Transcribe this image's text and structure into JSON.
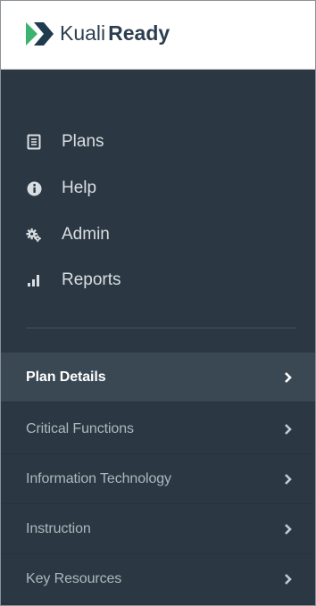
{
  "brand": {
    "name_light": "Kuali",
    "name_bold": "Ready"
  },
  "colors": {
    "sidebar_bg": "#2b3843",
    "active_bg": "#3a4853",
    "logo_green": "#3cb371",
    "logo_dark": "#1f3b4d"
  },
  "nav": [
    {
      "label": "Plans",
      "icon": "document-icon"
    },
    {
      "label": "Help",
      "icon": "info-icon"
    },
    {
      "label": "Admin",
      "icon": "gears-icon"
    },
    {
      "label": "Reports",
      "icon": "bar-chart-icon"
    }
  ],
  "sections": [
    {
      "label": "Plan Details",
      "active": true
    },
    {
      "label": "Critical Functions",
      "active": false
    },
    {
      "label": "Information Technology",
      "active": false
    },
    {
      "label": "Instruction",
      "active": false
    },
    {
      "label": "Key Resources",
      "active": false
    }
  ]
}
